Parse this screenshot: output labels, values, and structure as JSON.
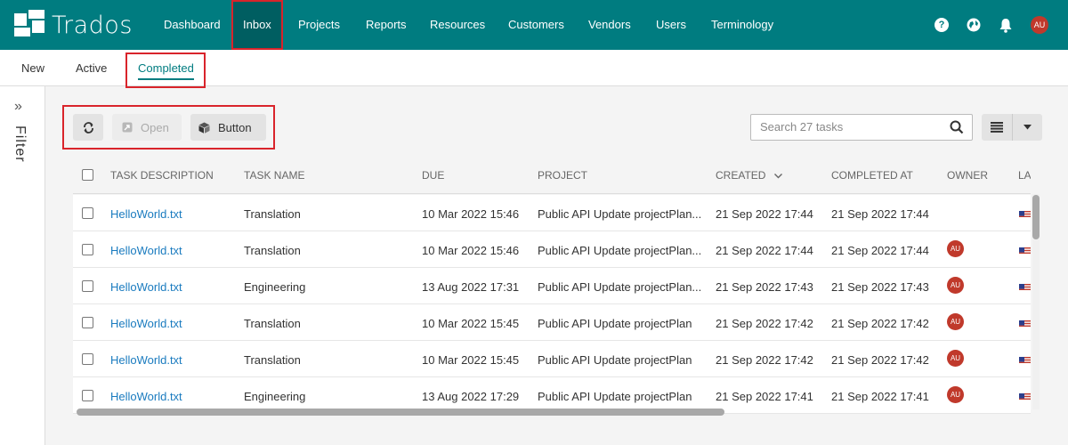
{
  "app": {
    "brand": "Trados",
    "nav": [
      {
        "label": "Dashboard",
        "active": false
      },
      {
        "label": "Inbox",
        "active": true
      },
      {
        "label": "Projects",
        "active": false
      },
      {
        "label": "Reports",
        "active": false
      },
      {
        "label": "Resources",
        "active": false
      },
      {
        "label": "Customers",
        "active": false
      },
      {
        "label": "Vendors",
        "active": false
      },
      {
        "label": "Users",
        "active": false
      },
      {
        "label": "Terminology",
        "active": false
      }
    ],
    "help_icon": "?",
    "user_initials": "AU"
  },
  "subtabs": [
    {
      "label": "New",
      "active": false
    },
    {
      "label": "Active",
      "active": false
    },
    {
      "label": "Completed",
      "active": true
    }
  ],
  "filter": {
    "label": "Filter"
  },
  "toolbar": {
    "refresh_icon": "refresh-icon",
    "open_label": "Open",
    "button_label": "Button",
    "search_placeholder": "Search 27 tasks"
  },
  "table": {
    "columns": [
      "TASK DESCRIPTION",
      "TASK NAME",
      "DUE",
      "PROJECT",
      "CREATED",
      "COMPLETED AT",
      "OWNER",
      "LANG"
    ],
    "sort_column": "CREATED",
    "rows": [
      {
        "description": "HelloWorld.txt",
        "task_name": "Translation",
        "due": "10 Mar 2022 15:46",
        "project": "Public API Update projectPlan...",
        "created": "21 Sep 2022 17:44",
        "completed": "21 Sep 2022 17:44",
        "owner": ""
      },
      {
        "description": "HelloWorld.txt",
        "task_name": "Translation",
        "due": "10 Mar 2022 15:46",
        "project": "Public API Update projectPlan...",
        "created": "21 Sep 2022 17:44",
        "completed": "21 Sep 2022 17:44",
        "owner": "AU"
      },
      {
        "description": "HelloWorld.txt",
        "task_name": "Engineering",
        "due": "13 Aug 2022 17:31",
        "project": "Public API Update projectPlan...",
        "created": "21 Sep 2022 17:43",
        "completed": "21 Sep 2022 17:43",
        "owner": "AU"
      },
      {
        "description": "HelloWorld.txt",
        "task_name": "Translation",
        "due": "10 Mar 2022 15:45",
        "project": "Public API Update projectPlan",
        "created": "21 Sep 2022 17:42",
        "completed": "21 Sep 2022 17:42",
        "owner": "AU"
      },
      {
        "description": "HelloWorld.txt",
        "task_name": "Translation",
        "due": "10 Mar 2022 15:45",
        "project": "Public API Update projectPlan",
        "created": "21 Sep 2022 17:42",
        "completed": "21 Sep 2022 17:42",
        "owner": "AU"
      },
      {
        "description": "HelloWorld.txt",
        "task_name": "Engineering",
        "due": "13 Aug 2022 17:29",
        "project": "Public API Update projectPlan",
        "created": "21 Sep 2022 17:41",
        "completed": "21 Sep 2022 17:41",
        "owner": "AU"
      }
    ]
  },
  "colors": {
    "brand": "#007c80",
    "brand_dark": "#005e61",
    "highlight": "#d9242b",
    "link": "#1a7bbf",
    "avatar": "#c0392b"
  }
}
